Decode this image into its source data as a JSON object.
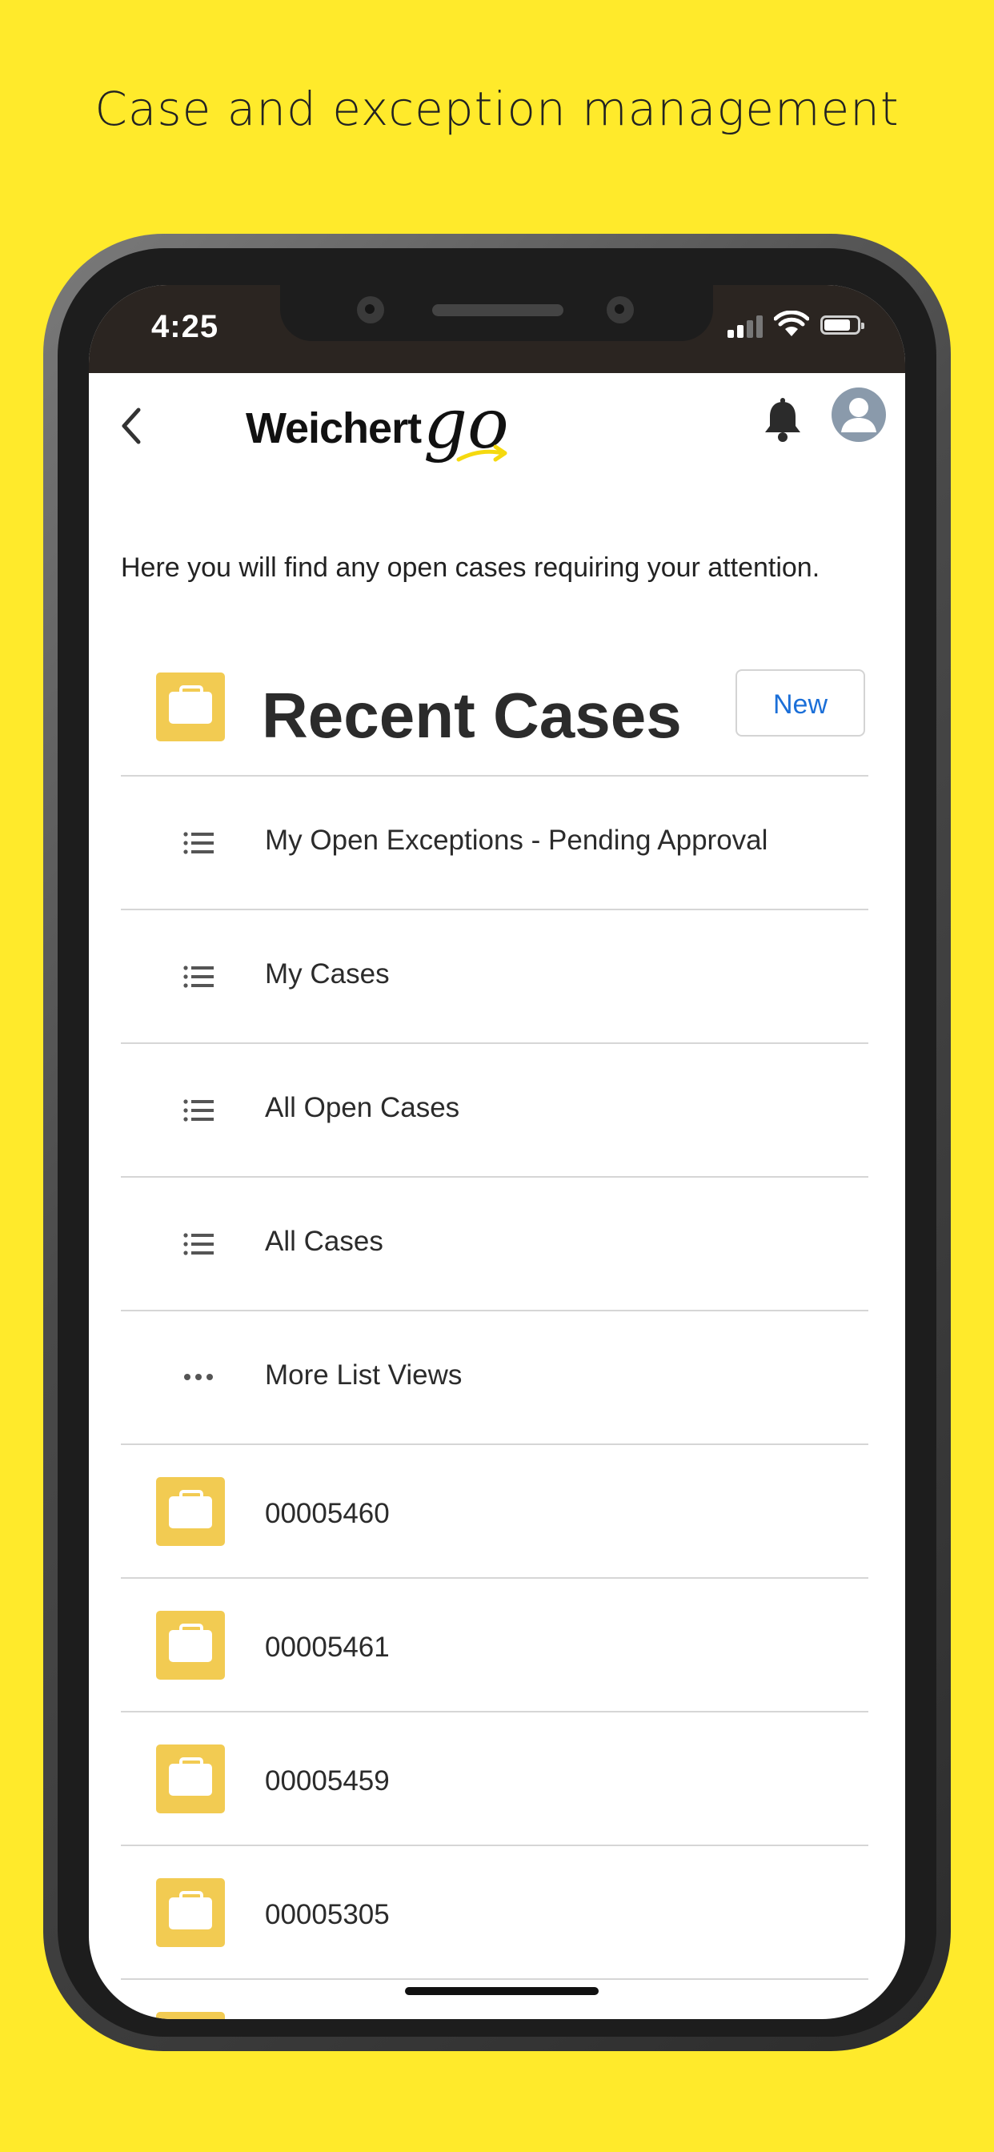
{
  "headline": "Case and exception management",
  "status_bar": {
    "time": "4:25"
  },
  "app_bar": {
    "brand_text": "Weichert",
    "brand_go": "go",
    "accent_color": "#FFEA2B"
  },
  "intro_text": "Here you will find any open cases requiring your attention.",
  "section": {
    "title": "Recent Cases",
    "new_button": "New",
    "icon": "briefcase-icon",
    "icon_color": "#F2CB52"
  },
  "list_views": [
    {
      "label": "My Open Exceptions - Pending Approval",
      "icon": "list-icon"
    },
    {
      "label": "My Cases",
      "icon": "list-icon"
    },
    {
      "label": "All Open Cases",
      "icon": "list-icon"
    },
    {
      "label": "All Cases",
      "icon": "list-icon"
    },
    {
      "label": "More List Views",
      "icon": "more-dots-icon"
    }
  ],
  "recent_cases": [
    {
      "number": "00005460",
      "icon": "briefcase-icon"
    },
    {
      "number": "00005461",
      "icon": "briefcase-icon"
    },
    {
      "number": "00005459",
      "icon": "briefcase-icon"
    },
    {
      "number": "00005305",
      "icon": "briefcase-icon"
    }
  ]
}
